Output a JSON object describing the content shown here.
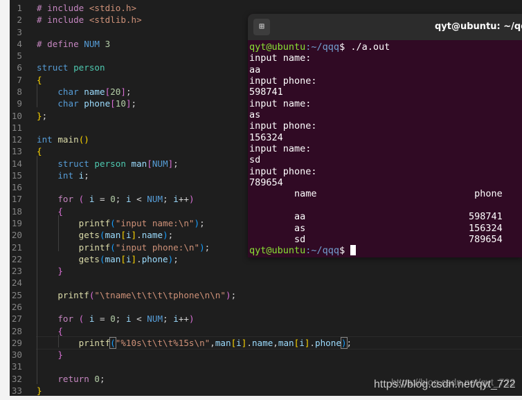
{
  "editor": {
    "lines": [
      [
        [
          "# include ",
          "pp"
        ],
        [
          "<stdio.h>",
          "inc"
        ]
      ],
      [
        [
          "# include ",
          "pp"
        ],
        [
          "<stdlib.h>",
          "inc"
        ]
      ],
      [],
      [
        [
          "# define ",
          "pp"
        ],
        [
          "NUM",
          "mac"
        ],
        [
          " 3",
          "num"
        ]
      ],
      [],
      [
        [
          "struct ",
          "kw"
        ],
        [
          "person",
          "ty"
        ]
      ],
      [
        [
          "{",
          "b1"
        ]
      ],
      [
        [
          "    char ",
          "kw"
        ],
        [
          "name",
          "var"
        ],
        [
          "[",
          "b2"
        ],
        [
          "20",
          "num"
        ],
        [
          "]",
          "b2"
        ],
        [
          ";",
          ""
        ]
      ],
      [
        [
          "    char ",
          "kw"
        ],
        [
          "phone",
          "var"
        ],
        [
          "[",
          "b2"
        ],
        [
          "10",
          "num"
        ],
        [
          "]",
          "b2"
        ],
        [
          ";",
          ""
        ]
      ],
      [
        [
          "}",
          "b1"
        ],
        [
          ";",
          ""
        ]
      ],
      [],
      [
        [
          "int ",
          "kw"
        ],
        [
          "main",
          "fn"
        ],
        [
          "()",
          "b1"
        ]
      ],
      [
        [
          "{",
          "b1"
        ]
      ],
      [
        [
          "    struct ",
          "kw"
        ],
        [
          "person ",
          "ty"
        ],
        [
          "man",
          "var"
        ],
        [
          "[",
          "b2"
        ],
        [
          "NUM",
          "mac"
        ],
        [
          "]",
          "b2"
        ],
        [
          ";",
          ""
        ]
      ],
      [
        [
          "    int ",
          "kw"
        ],
        [
          "i",
          "var"
        ],
        [
          ";",
          ""
        ]
      ],
      [],
      [
        [
          "    for ",
          "ctl"
        ],
        [
          "(",
          "b2"
        ],
        [
          " i ",
          "var"
        ],
        [
          "= ",
          ""
        ],
        [
          "0",
          "num"
        ],
        [
          "; ",
          ""
        ],
        [
          "i ",
          "var"
        ],
        [
          "< ",
          ""
        ],
        [
          "NUM",
          "mac"
        ],
        [
          "; ",
          ""
        ],
        [
          "i",
          "var"
        ],
        [
          "++",
          ""
        ],
        [
          ")",
          "b2"
        ]
      ],
      [
        [
          "    {",
          "b2"
        ]
      ],
      [
        [
          "        printf",
          "fn"
        ],
        [
          "(",
          "b3"
        ],
        [
          "\"input name:\\n\"",
          "str"
        ],
        [
          ")",
          "b3"
        ],
        [
          ";",
          ""
        ]
      ],
      [
        [
          "        gets",
          "fn"
        ],
        [
          "(",
          "b3"
        ],
        [
          "man",
          "var"
        ],
        [
          "[",
          "b1"
        ],
        [
          "i",
          "var"
        ],
        [
          "]",
          "b1"
        ],
        [
          ".",
          ""
        ],
        [
          "name",
          "var"
        ],
        [
          ")",
          "b3"
        ],
        [
          ";",
          ""
        ]
      ],
      [
        [
          "        printf",
          "fn"
        ],
        [
          "(",
          "b3"
        ],
        [
          "\"input phone:\\n\"",
          "str"
        ],
        [
          ")",
          "b3"
        ],
        [
          ";",
          ""
        ]
      ],
      [
        [
          "        gets",
          "fn"
        ],
        [
          "(",
          "b3"
        ],
        [
          "man",
          "var"
        ],
        [
          "[",
          "b1"
        ],
        [
          "i",
          "var"
        ],
        [
          "]",
          "b1"
        ],
        [
          ".",
          ""
        ],
        [
          "phone",
          "var"
        ],
        [
          ")",
          "b3"
        ],
        [
          ";",
          ""
        ]
      ],
      [
        [
          "    }",
          "b2"
        ]
      ],
      [],
      [
        [
          "    printf",
          "fn"
        ],
        [
          "(",
          "b2"
        ],
        [
          "\"\\tname\\t\\t\\t\\tphone\\n\\n\"",
          "str"
        ],
        [
          ")",
          "b2"
        ],
        [
          ";",
          ""
        ]
      ],
      [],
      [
        [
          "    for ",
          "ctl"
        ],
        [
          "(",
          "b2"
        ],
        [
          " i ",
          "var"
        ],
        [
          "= ",
          ""
        ],
        [
          "0",
          "num"
        ],
        [
          "; ",
          ""
        ],
        [
          "i ",
          "var"
        ],
        [
          "< ",
          ""
        ],
        [
          "NUM",
          "mac"
        ],
        [
          "; ",
          ""
        ],
        [
          "i",
          "var"
        ],
        [
          "++",
          ""
        ],
        [
          ")",
          "b2"
        ]
      ],
      [
        [
          "    {",
          "b2"
        ]
      ],
      [
        [
          "        printf",
          "fn"
        ],
        [
          "(",
          "b3 hl"
        ],
        [
          "\"%10s\\t\\t\\t%15s\\n\"",
          "str"
        ],
        [
          ",",
          ""
        ],
        [
          "man",
          "var"
        ],
        [
          "[",
          "b1"
        ],
        [
          "i",
          "var"
        ],
        [
          "]",
          "b1"
        ],
        [
          ".",
          ""
        ],
        [
          "name",
          "var"
        ],
        [
          ",",
          ""
        ],
        [
          "man",
          "var"
        ],
        [
          "[",
          "b1"
        ],
        [
          "i",
          "var"
        ],
        [
          "]",
          "b1"
        ],
        [
          ".",
          ""
        ],
        [
          "phone",
          "var"
        ],
        [
          ")",
          "b3 hl"
        ],
        [
          ";",
          ""
        ]
      ],
      [
        [
          "    }",
          "b2"
        ]
      ],
      [],
      [
        [
          "    return ",
          "ctl"
        ],
        [
          "0",
          "num"
        ],
        [
          ";",
          ""
        ]
      ],
      [
        [
          "}",
          "b1"
        ]
      ]
    ]
  },
  "terminal": {
    "title": "qyt@ubuntu: ~/qqq",
    "new_tab_icon": "new-tab-icon",
    "prompt_user": "qyt@ubuntu",
    "prompt_path": ":~/qqq",
    "prompt_symbol": "$ ",
    "command": "./a.out",
    "output": [
      "input name:",
      "aa",
      "input phone:",
      "598741",
      "input name:",
      "as",
      "input phone:",
      "156324",
      "input name:",
      "sd",
      "input phone:",
      "789654",
      "        name                            phone",
      "",
      "        aa                             598741",
      "        as                             156324",
      "        sd                             789654"
    ]
  },
  "watermark": "https://blog.csdn.net/qyt_722"
}
